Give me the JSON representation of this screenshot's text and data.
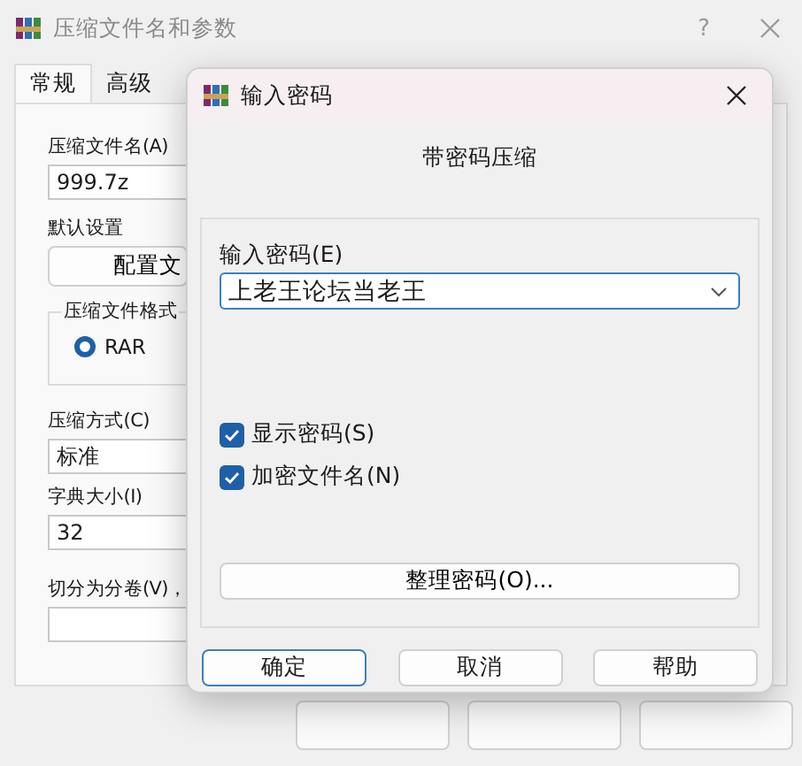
{
  "window": {
    "title": "压缩文件名和参数",
    "help": "?"
  },
  "tabs": [
    {
      "label": "常规",
      "selected": true
    },
    {
      "label": "高级",
      "selected": false
    }
  ],
  "general": {
    "archive_name_label": "压缩文件名(A)",
    "archive_name": "999.7z",
    "default_settings_label": "默认设置",
    "profiles_button": "配置文",
    "format_group": "压缩文件格式",
    "formats": [
      {
        "label": "RAR",
        "selected": true
      }
    ],
    "method_label": "压缩方式(C)",
    "method": "标准",
    "dictionary_label": "字典大小(I)",
    "dictionary": "32",
    "split_label": "切分为分卷(V)，"
  },
  "password_dialog": {
    "title": "输入密码",
    "heading": "带密码压缩",
    "password_label": "输入密码(E)",
    "password": "上老王论坛当老王",
    "options": [
      {
        "label": "显示密码(S)",
        "checked": true
      },
      {
        "label": "加密文件名(N)",
        "checked": true
      }
    ],
    "organize_button": "整理密码(O)...",
    "buttons": [
      {
        "label": "确定",
        "default": true
      },
      {
        "label": "取消",
        "default": false
      },
      {
        "label": "帮助",
        "default": false
      }
    ]
  }
}
